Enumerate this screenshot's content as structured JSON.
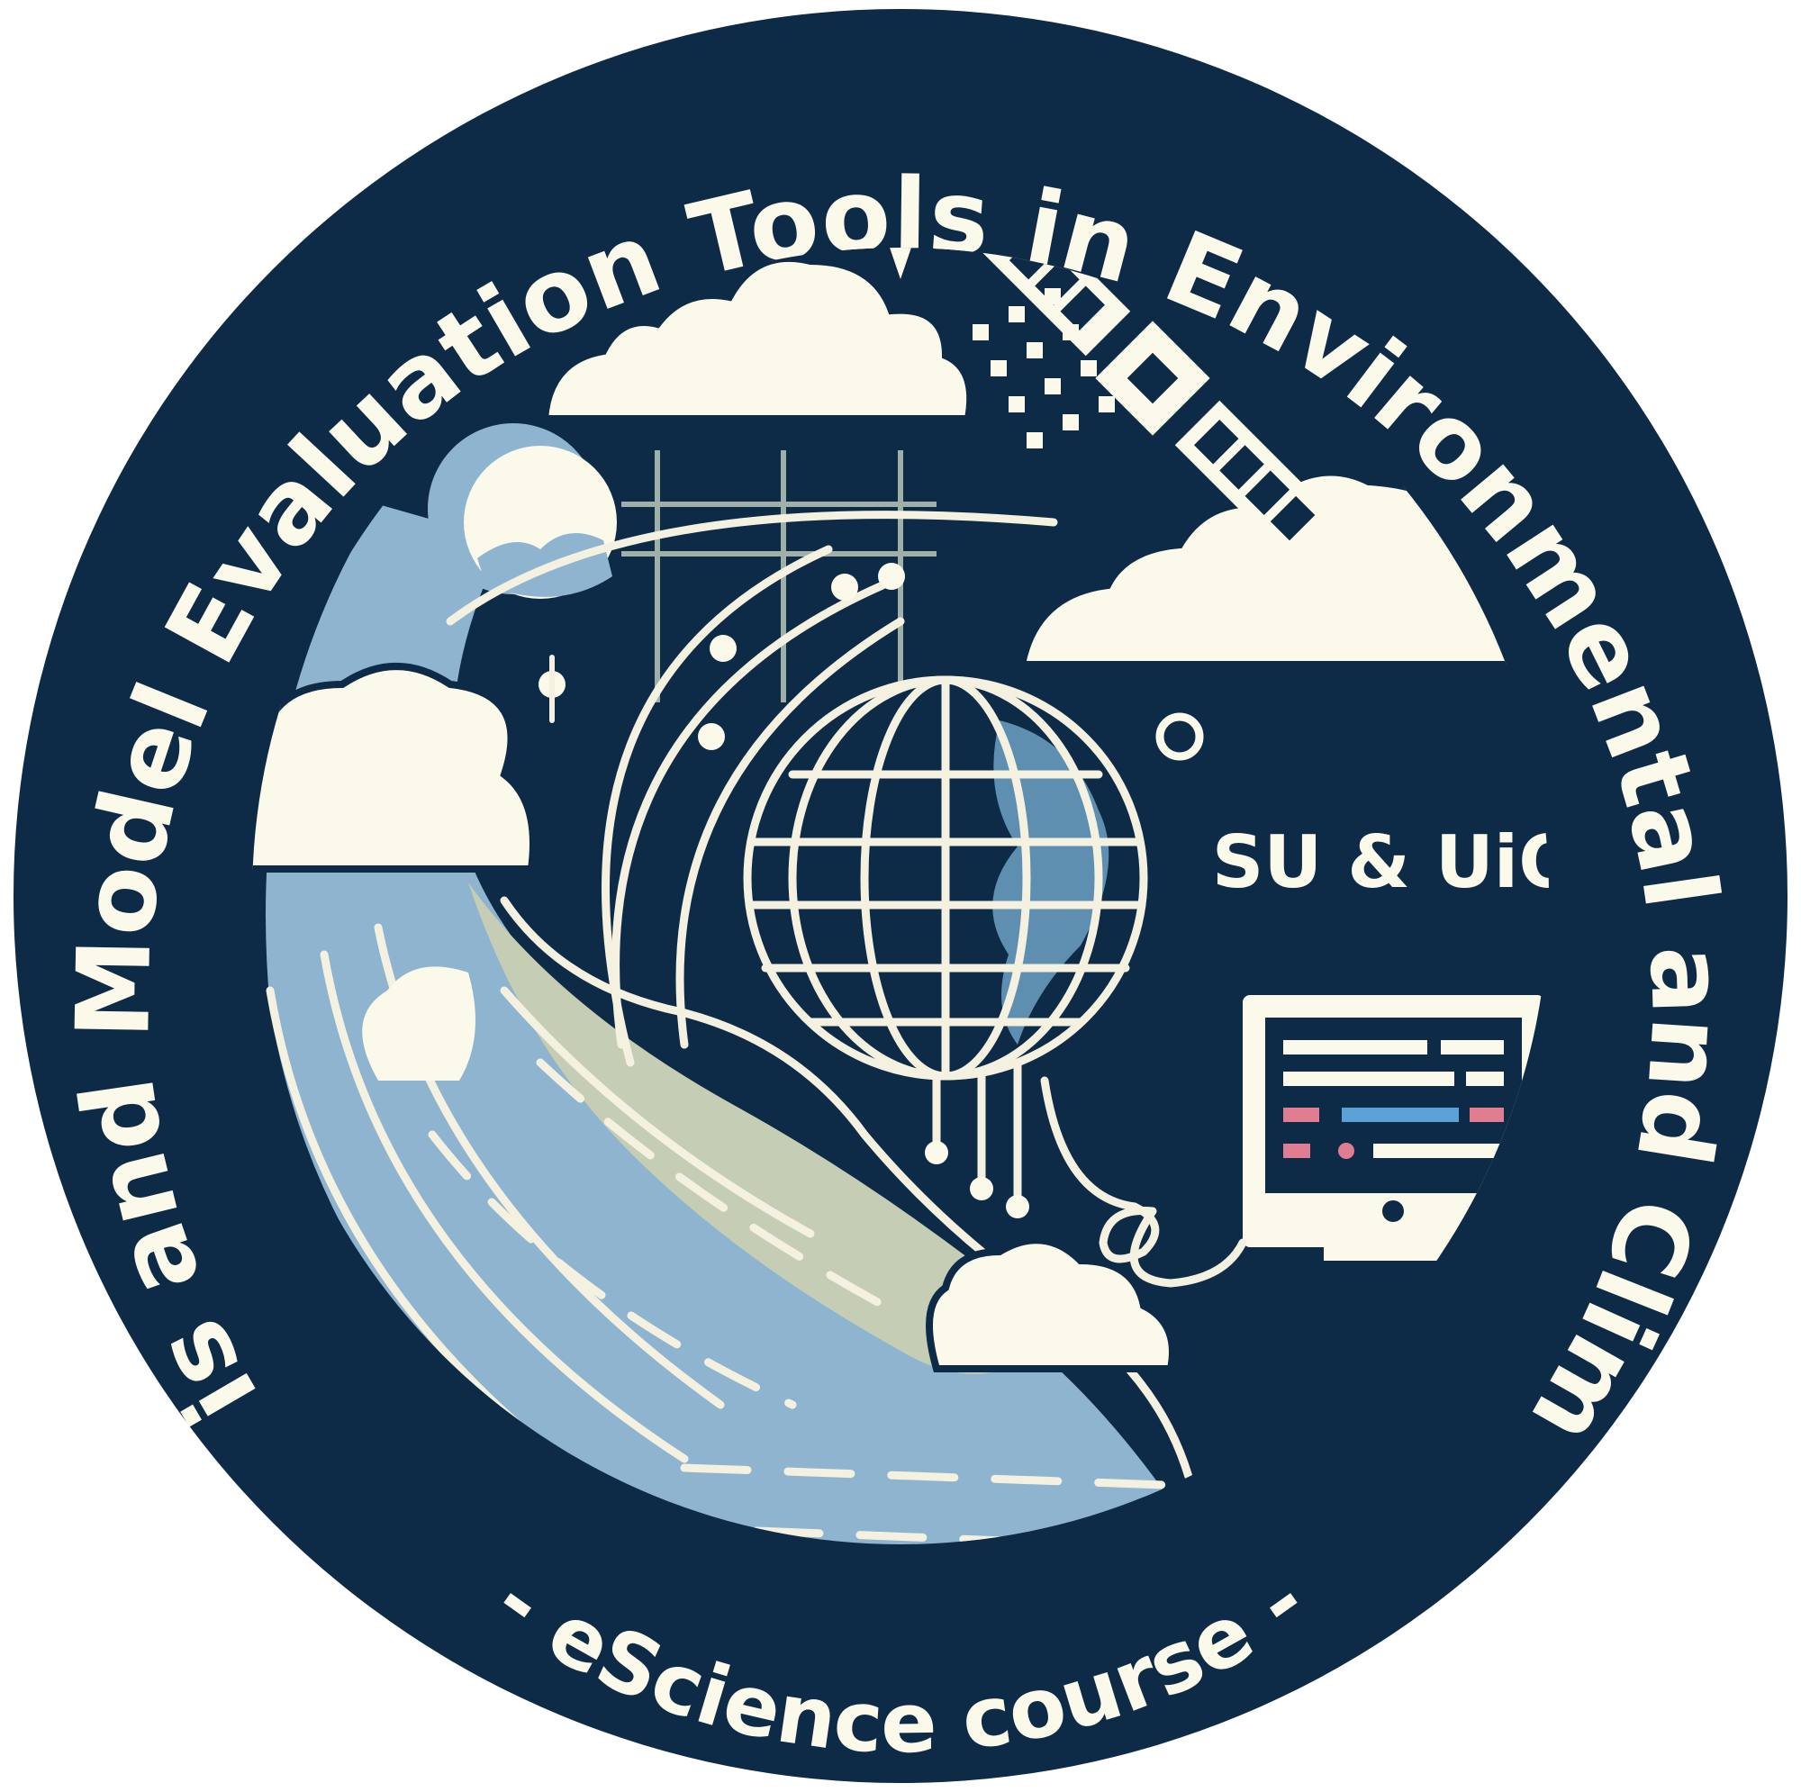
{
  "badge": {
    "title_arc": "Data Analysis and Model Evaluation Tools in Environmental and Climate Science",
    "course_arc": "- eScience course -",
    "affiliation": "SU & UiO"
  },
  "colors": {
    "navy": "#0d2a46",
    "cream": "#fbf9ea",
    "blue": "#8fb4cf",
    "sage": "#c6cdb5",
    "pink": "#e07d90",
    "accent_blue": "#5ba3d6"
  },
  "icons": [
    "cloud-icon",
    "satellite-icon",
    "globe-icon",
    "computer-monitor-icon",
    "sparkle-icon",
    "moon-icon",
    "wave-icon"
  ]
}
